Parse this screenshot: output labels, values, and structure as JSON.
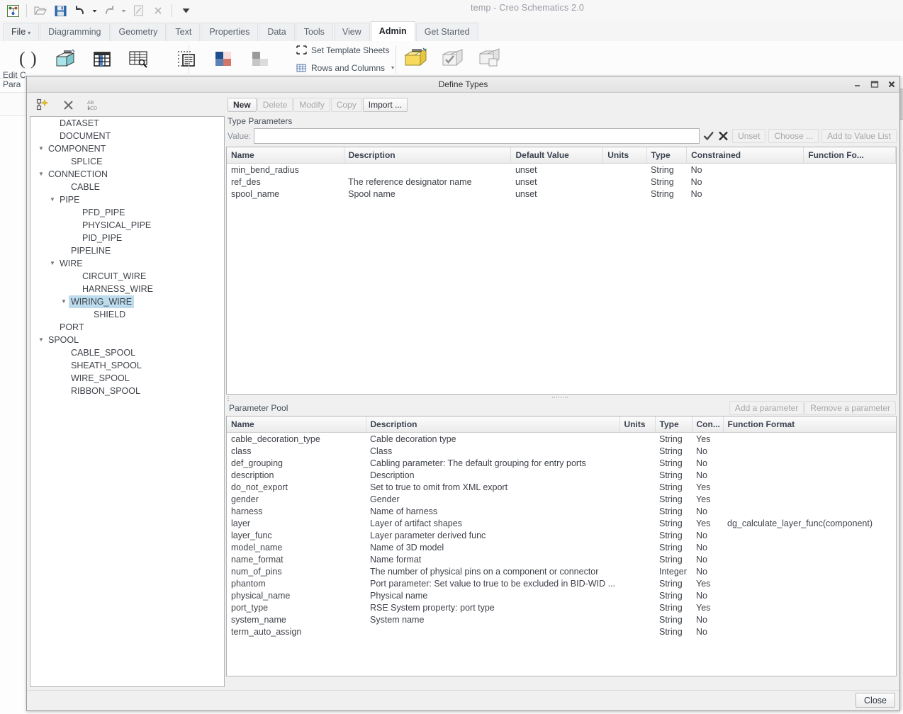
{
  "window": {
    "title": "temp - Creo Schematics 2.0"
  },
  "quick_access": {
    "items": [
      {
        "name": "app-logo-icon",
        "label": "Creo Schematics"
      },
      {
        "name": "open-icon",
        "label": "Open"
      },
      {
        "name": "save-icon",
        "label": "Save"
      },
      {
        "name": "undo-icon",
        "label": "Undo"
      },
      {
        "name": "undo-dropdown-icon",
        "label": "Undo options"
      },
      {
        "name": "redo-icon",
        "label": "Redo"
      },
      {
        "name": "redo-dropdown-icon",
        "label": "Redo options"
      },
      {
        "name": "regenerate-icon",
        "label": "Regenerate"
      },
      {
        "name": "close-window-icon",
        "label": "Close"
      },
      {
        "name": "customize-toolbar-icon",
        "label": "Customize Quick Access Toolbar"
      }
    ]
  },
  "ribbon": {
    "tabs": [
      {
        "label": "File",
        "caret": "▾",
        "active": false
      },
      {
        "label": "Diagramming",
        "active": false
      },
      {
        "label": "Geometry",
        "active": false
      },
      {
        "label": "Text",
        "active": false
      },
      {
        "label": "Properties",
        "active": false
      },
      {
        "label": "Data",
        "active": false
      },
      {
        "label": "Tools",
        "active": false
      },
      {
        "label": "View",
        "active": false
      },
      {
        "label": "Admin",
        "active": true
      },
      {
        "label": "Get Started",
        "active": false
      }
    ],
    "buttons": [
      {
        "name": "edit-catalog-parameters-icon",
        "label": "Edit Catalog Parameters"
      },
      {
        "name": "catalog-icon",
        "label": "Catalog"
      },
      {
        "name": "table-icon",
        "label": "Table"
      },
      {
        "name": "table-search-icon",
        "label": "Find Table"
      },
      {
        "name": "list-icon",
        "label": "List"
      },
      {
        "name": "color-scheme-icon",
        "label": "Color Scheme"
      },
      {
        "name": "grayscale-icon",
        "label": "Grayscale"
      },
      {
        "name": "define-types-icon",
        "label": "Define Types"
      },
      {
        "name": "validate-types-icon",
        "label": "Validate Types"
      },
      {
        "name": "copy-types-icon",
        "label": "Copy Types"
      }
    ],
    "text_buttons": [
      {
        "name": "set-template-sheets-button",
        "label": "Set Template Sheets",
        "icon": "template-sheet-icon"
      },
      {
        "name": "rows-and-columns-button",
        "label": "Rows and Columns",
        "icon": "rows-columns-icon",
        "caret": "▾"
      }
    ],
    "group_label_line1": "Edit C",
    "group_label_line2": "Para"
  },
  "dialog": {
    "title": "Define Types",
    "titlebar_buttons": [
      {
        "name": "minimize-button",
        "glyph": "–"
      },
      {
        "name": "maximize-button",
        "glyph": "□"
      },
      {
        "name": "close-button",
        "glyph": "✕"
      }
    ],
    "tree_toolbar": [
      {
        "name": "new-type-icon",
        "label": "New Type"
      },
      {
        "name": "delete-type-icon",
        "label": "Delete Type"
      },
      {
        "name": "rename-type-icon",
        "label": "Rename Type"
      }
    ],
    "tree": [
      {
        "label": "DATASET",
        "depth": 1,
        "twisty": "",
        "selected": false
      },
      {
        "label": "DOCUMENT",
        "depth": 1,
        "twisty": "",
        "selected": false
      },
      {
        "label": "COMPONENT",
        "depth": 0,
        "twisty": "▼",
        "selected": false
      },
      {
        "label": "SPLICE",
        "depth": 2,
        "twisty": "",
        "selected": false
      },
      {
        "label": "CONNECTION",
        "depth": 0,
        "twisty": "▼",
        "selected": false
      },
      {
        "label": "CABLE",
        "depth": 2,
        "twisty": "",
        "selected": false
      },
      {
        "label": "PIPE",
        "depth": 1,
        "twisty": "▼",
        "selected": false
      },
      {
        "label": "PFD_PIPE",
        "depth": 3,
        "twisty": "",
        "selected": false
      },
      {
        "label": "PHYSICAL_PIPE",
        "depth": 3,
        "twisty": "",
        "selected": false
      },
      {
        "label": "PID_PIPE",
        "depth": 3,
        "twisty": "",
        "selected": false
      },
      {
        "label": "PIPELINE",
        "depth": 2,
        "twisty": "",
        "selected": false
      },
      {
        "label": "WIRE",
        "depth": 1,
        "twisty": "▼",
        "selected": false
      },
      {
        "label": "CIRCUIT_WIRE",
        "depth": 3,
        "twisty": "",
        "selected": false
      },
      {
        "label": "HARNESS_WIRE",
        "depth": 3,
        "twisty": "",
        "selected": false
      },
      {
        "label": "WIRING_WIRE",
        "depth": 2,
        "twisty": "▼",
        "selected": true
      },
      {
        "label": "SHIELD",
        "depth": 4,
        "twisty": "",
        "selected": false
      },
      {
        "label": "PORT",
        "depth": 1,
        "twisty": "",
        "selected": false
      },
      {
        "label": "SPOOL",
        "depth": 0,
        "twisty": "▼",
        "selected": false
      },
      {
        "label": "CABLE_SPOOL",
        "depth": 2,
        "twisty": "",
        "selected": false
      },
      {
        "label": "SHEATH_SPOOL",
        "depth": 2,
        "twisty": "",
        "selected": false
      },
      {
        "label": "WIRE_SPOOL",
        "depth": 2,
        "twisty": "",
        "selected": false
      },
      {
        "label": "RIBBON_SPOOL",
        "depth": 2,
        "twisty": "",
        "selected": false
      }
    ],
    "command_buttons": [
      {
        "label": "New",
        "enabled": true,
        "strong": true
      },
      {
        "label": "Delete",
        "enabled": false,
        "strong": false
      },
      {
        "label": "Modify",
        "enabled": false,
        "strong": false
      },
      {
        "label": "Copy",
        "enabled": false,
        "strong": false
      },
      {
        "label": "Import ...",
        "enabled": true,
        "strong": false
      }
    ],
    "type_parameters": {
      "section_label": "Type Parameters",
      "value_label": "Value:",
      "value": "",
      "value_placeholder": "",
      "accept_icon": "check-icon",
      "reject_icon": "cancel-icon",
      "side_buttons": [
        {
          "label": "Unset",
          "enabled": false
        },
        {
          "label": "Choose ...",
          "enabled": false
        },
        {
          "label": "Add to Value List",
          "enabled": false
        }
      ],
      "columns": [
        "Name",
        "Description",
        "Default Value",
        "Units",
        "Type",
        "Constrained",
        "Function Fo..."
      ],
      "rows": [
        [
          "min_bend_radius",
          "",
          "unset",
          "",
          "String",
          "No",
          ""
        ],
        [
          "ref_des",
          "The reference designator name",
          "unset",
          "",
          "String",
          "No",
          ""
        ],
        [
          "spool_name",
          "Spool name",
          "unset",
          "",
          "String",
          "No",
          ""
        ]
      ]
    },
    "parameter_pool": {
      "section_label": "Parameter Pool",
      "buttons": [
        {
          "label": "Add a parameter",
          "enabled": false
        },
        {
          "label": "Remove a parameter",
          "enabled": false
        }
      ],
      "columns": [
        "Name",
        "Description",
        "Units",
        "Type",
        "Con...",
        "Function Format"
      ],
      "rows": [
        [
          "cable_decoration_type",
          "Cable decoration type",
          "",
          "String",
          "Yes",
          ""
        ],
        [
          "class",
          "Class",
          "",
          "String",
          "No",
          ""
        ],
        [
          "def_grouping",
          "Cabling parameter: The default grouping for entry ports",
          "",
          "String",
          "No",
          ""
        ],
        [
          "description",
          "Description",
          "",
          "String",
          "No",
          ""
        ],
        [
          "do_not_export",
          "Set to true to omit from XML export",
          "",
          "String",
          "Yes",
          ""
        ],
        [
          "gender",
          "Gender",
          "",
          "String",
          "Yes",
          ""
        ],
        [
          "harness",
          "Name of harness",
          "",
          "String",
          "No",
          ""
        ],
        [
          "layer",
          "Layer of artifact shapes",
          "",
          "String",
          "Yes",
          "dg_calculate_layer_func(component)"
        ],
        [
          "layer_func",
          "Layer parameter derived func",
          "",
          "String",
          "No",
          ""
        ],
        [
          "model_name",
          "Name of 3D model",
          "",
          "String",
          "No",
          ""
        ],
        [
          "name_format",
          "Name format",
          "",
          "String",
          "No",
          ""
        ],
        [
          "num_of_pins",
          "The number of physical pins on a component or connector",
          "",
          "Integer",
          "No",
          ""
        ],
        [
          "phantom",
          "Port parameter: Set value to true to be excluded in BID-WID ...",
          "",
          "String",
          "Yes",
          ""
        ],
        [
          "physical_name",
          "Physical name",
          "",
          "String",
          "No",
          ""
        ],
        [
          "port_type",
          "RSE System property: port type",
          "",
          "String",
          "Yes",
          ""
        ],
        [
          "system_name",
          "System name",
          "",
          "String",
          "No",
          ""
        ],
        [
          "term_auto_assign",
          "",
          "",
          "String",
          "No",
          ""
        ]
      ]
    },
    "footer": {
      "close_label": "Close"
    }
  },
  "colors": {
    "selection": "#bcdcee",
    "header_text": "#3b4350",
    "body_text": "#3f434a",
    "disabled_text": "#a8a8a8",
    "dialog_bg": "#f0f0f0"
  }
}
